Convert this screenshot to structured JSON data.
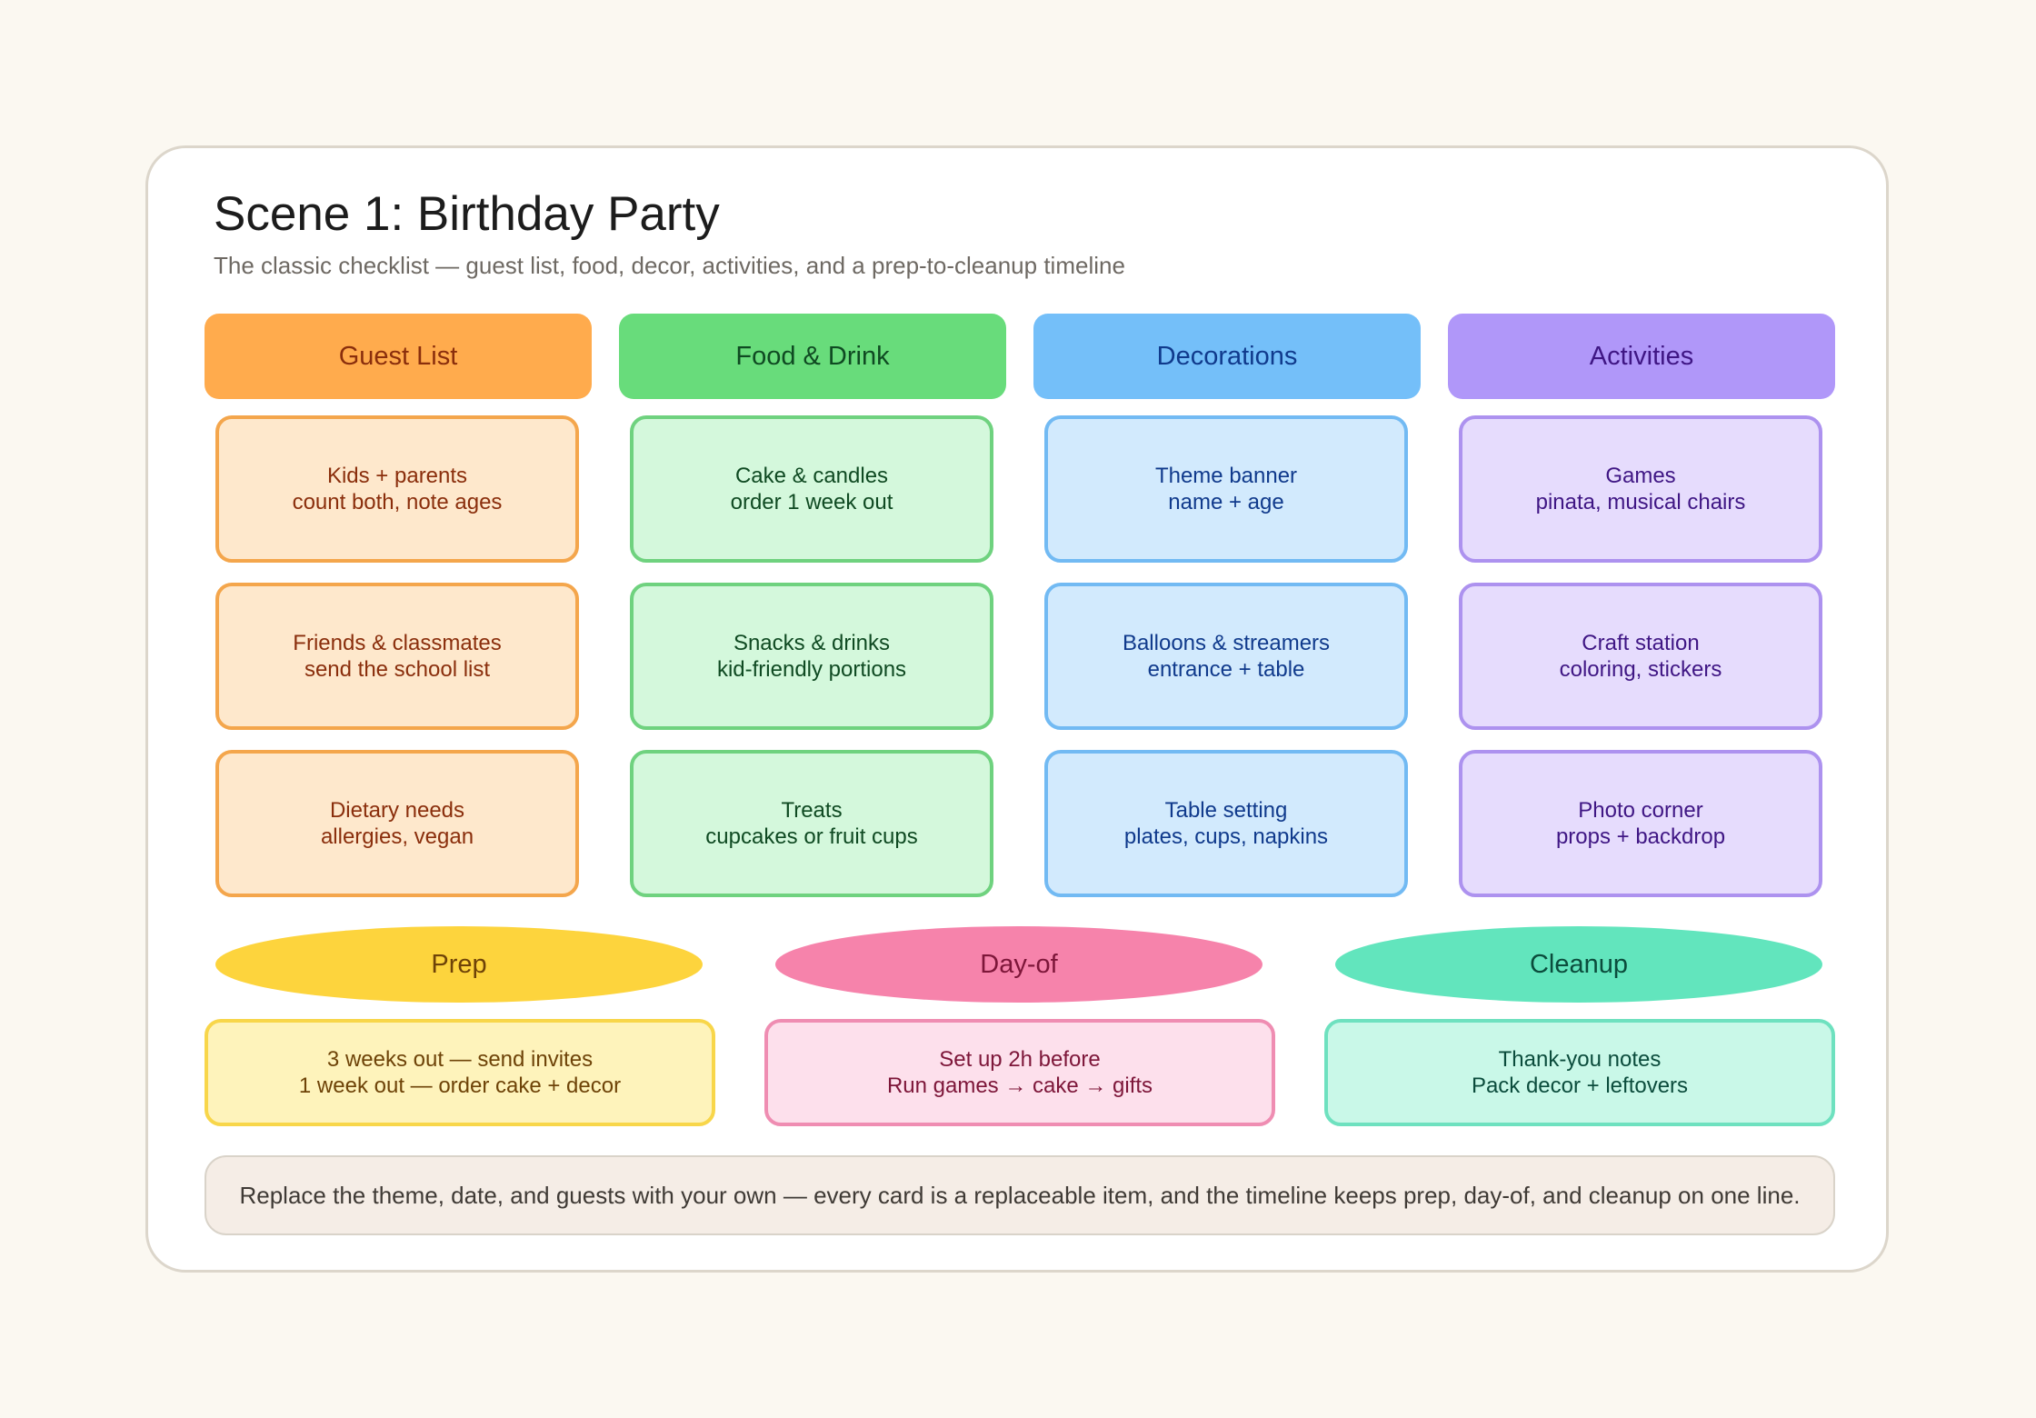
{
  "title": "Scene 1: Birthday Party",
  "subtitle": "The classic checklist — guest list, food, decor, activities, and a prep-to-cleanup timeline",
  "columns": [
    {
      "name": "Guest List",
      "header_color": "#ffab4d",
      "header_text_color": "#8a2e0c",
      "card_fill": "#fee8cc",
      "card_border": "#f4a64c",
      "card_text_color": "#8a2e0c",
      "cards": [
        {
          "title": "Kids + parents",
          "detail": "count both, note ages"
        },
        {
          "title": "Friends & classmates",
          "detail": "send the school list"
        },
        {
          "title": "Dietary needs",
          "detail": "allergies, vegan"
        }
      ]
    },
    {
      "name": "Food & Drink",
      "header_color": "#68dc7b",
      "header_text_color": "#0f4a22",
      "card_fill": "#d4f8dc",
      "card_border": "#6fd27f",
      "card_text_color": "#0f4a22",
      "cards": [
        {
          "title": "Cake & candles",
          "detail": "order 1 week out"
        },
        {
          "title": "Snacks & drinks",
          "detail": "kid-friendly portions"
        },
        {
          "title": "Treats",
          "detail": "cupcakes or fruit cups"
        }
      ]
    },
    {
      "name": "Decorations",
      "header_color": "#74bff9",
      "header_text_color": "#103a8c",
      "card_fill": "#d2eafd",
      "card_border": "#72baf3",
      "card_text_color": "#103a8c",
      "cards": [
        {
          "title": "Theme banner",
          "detail": "name + age"
        },
        {
          "title": "Balloons & streamers",
          "detail": "entrance + table"
        },
        {
          "title": "Table setting",
          "detail": "plates, cups, napkins"
        }
      ]
    },
    {
      "name": "Activities",
      "header_color": "#b097f9",
      "header_text_color": "#3f1684",
      "card_fill": "#e6dcfd",
      "card_border": "#ad92ef",
      "card_text_color": "#3f1684",
      "cards": [
        {
          "title": "Games",
          "detail": "pinata, musical chairs"
        },
        {
          "title": "Craft station",
          "detail": "coloring, stickers"
        },
        {
          "title": "Photo corner",
          "detail": "props + backdrop"
        }
      ]
    }
  ],
  "timeline": [
    {
      "phase": "Prep",
      "pill_color": "#fdd43d",
      "text_color": "#6e4308",
      "card_fill": "#fef3bb",
      "card_border": "#f8d64a",
      "lines": [
        "3 weeks out — send invites",
        "1 week out — order cake + decor"
      ]
    },
    {
      "phase": "Day-of",
      "pill_color": "#f683ab",
      "text_color": "#7d1639",
      "card_fill": "#fde0ec",
      "card_border": "#ef8db2",
      "lines": [
        "Set up 2h before",
        "Run games → cake → gifts"
      ]
    },
    {
      "phase": "Cleanup",
      "pill_color": "#62e5bd",
      "text_color": "#0b4c3c",
      "card_fill": "#c9f8e8",
      "card_border": "#6ee1bf",
      "lines": [
        "Thank-you notes",
        "Pack decor + leftovers"
      ]
    }
  ],
  "footer_note": "Replace the theme, date, and guests with your own — every card is a replaceable item, and the timeline keeps prep, day-of, and cleanup on one line."
}
